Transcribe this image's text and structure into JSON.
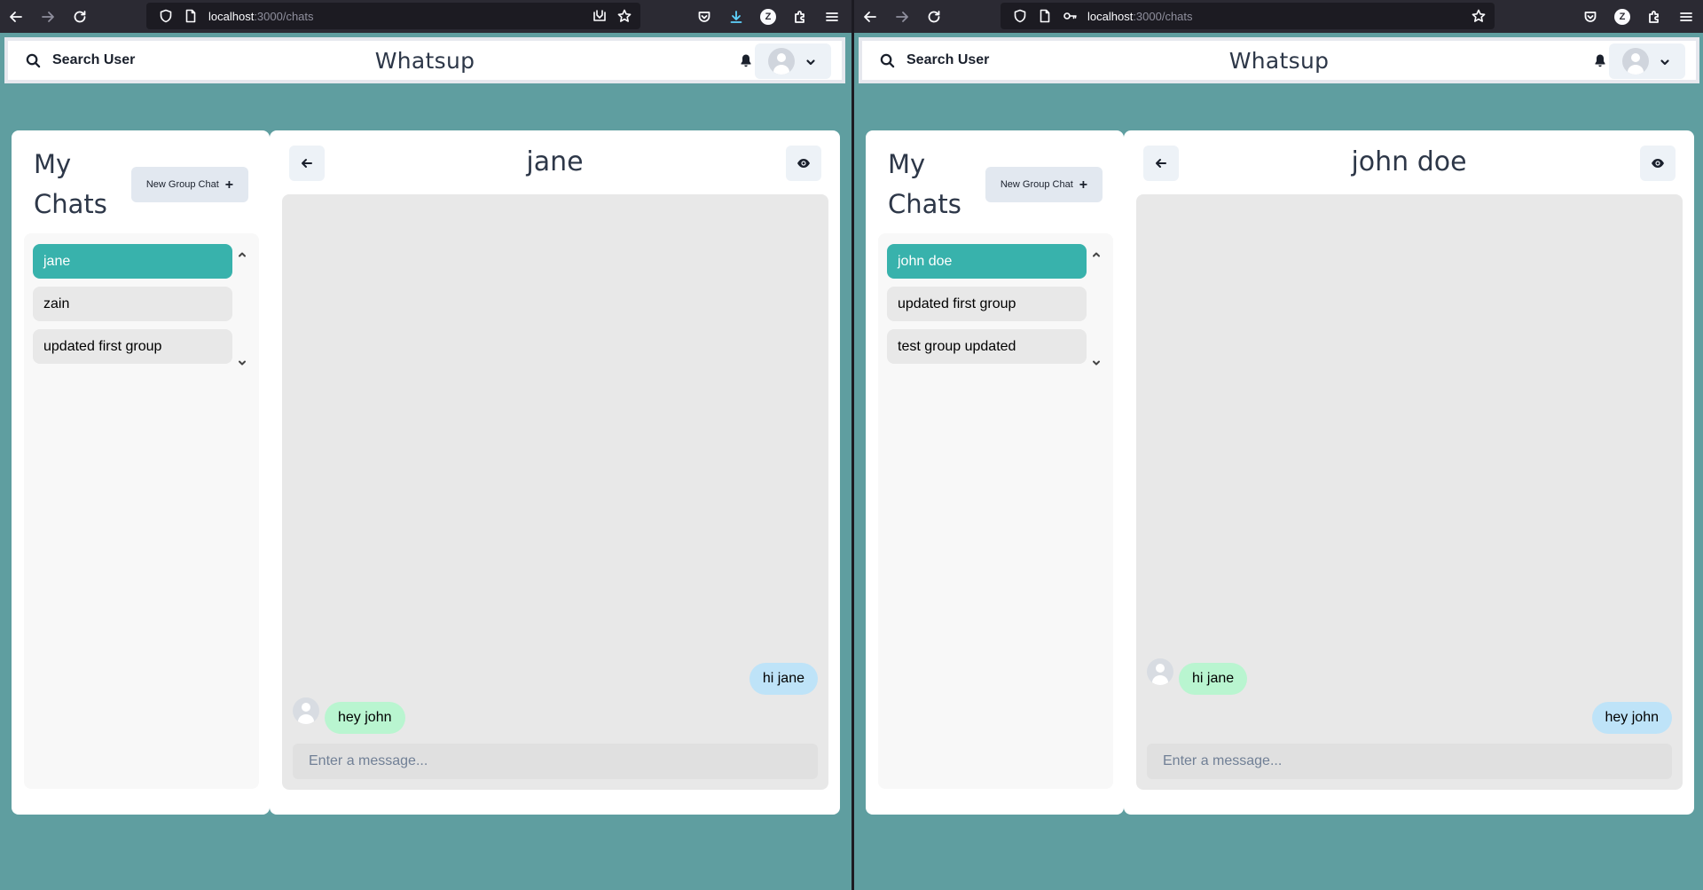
{
  "windows": [
    {
      "browser": {
        "url_host": "localhost",
        "url_rest": ":3000/chats"
      },
      "app": {
        "search_label": "Search User",
        "brand": "Whatsup",
        "my_chats_title": "My Chats",
        "new_group_label": "New Group Chat",
        "new_group_plus": "+",
        "chats": [
          {
            "name": "jane",
            "active": true
          },
          {
            "name": "zain",
            "active": false
          },
          {
            "name": "updated first group",
            "active": false
          }
        ],
        "chat_title": "jane",
        "messages": [
          {
            "text": "hi jane",
            "sender": "self",
            "avatar": false
          },
          {
            "text": "hey john",
            "sender": "other",
            "avatar": true
          }
        ],
        "input_placeholder": "Enter a message..."
      }
    },
    {
      "browser": {
        "url_host": "localhost",
        "url_rest": ":3000/chats"
      },
      "app": {
        "search_label": "Search User",
        "brand": "Whatsup",
        "my_chats_title": "My Chats",
        "new_group_label": "New Group Chat",
        "new_group_plus": "+",
        "chats": [
          {
            "name": "john doe",
            "active": true
          },
          {
            "name": "updated first group",
            "active": false
          },
          {
            "name": "test group updated",
            "active": false
          }
        ],
        "chat_title": "john doe",
        "messages": [
          {
            "text": "hi jane",
            "sender": "other",
            "avatar": true
          },
          {
            "text": "hey john",
            "sender": "self",
            "avatar": false
          }
        ],
        "input_placeholder": "Enter a message..."
      }
    }
  ],
  "colors": {
    "page_bg": "#5f9ea0",
    "active_chat": "#38b2ac",
    "sent_bubble": "#bee3f8",
    "received_bubble": "#b9f5d0"
  }
}
